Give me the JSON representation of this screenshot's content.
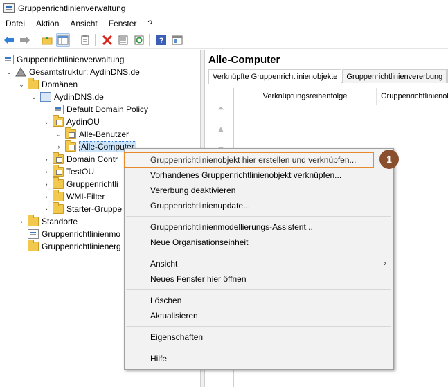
{
  "window": {
    "title": "Gruppenrichtlinienverwaltung"
  },
  "menu": [
    "Datei",
    "Aktion",
    "Ansicht",
    "Fenster",
    "?"
  ],
  "toolbar": {
    "buttons": [
      "back-icon",
      "forward-icon",
      "up-folder-icon",
      "show-hide-tree-icon",
      "clipboard-icon",
      "delete-icon",
      "properties-icon",
      "refresh-icon",
      "help-icon",
      "console-icon"
    ]
  },
  "tree": {
    "root": "Gruppenrichtlinienverwaltung",
    "forest": "Gesamtstruktur: AydinDNS.de",
    "domains": "Domänen",
    "domain": "AydinDNS.de",
    "default_policy": "Default Domain Policy",
    "ou": "AydinOU",
    "ou_users": "Alle-Benutzer",
    "ou_computers": "Alle-Computer",
    "domain_controllers": "Domain Contr",
    "testou": "TestOU",
    "gpos": "Gruppenrichtli",
    "wmi": "WMI-Filter",
    "starter": "Starter-Gruppe",
    "sites": "Standorte",
    "modeling": "Gruppenrichtlinienmo",
    "results": "Gruppenrichtlinienerg"
  },
  "right_pane": {
    "title": "Alle-Computer",
    "tabs": [
      "Verknüpfte Gruppenrichtlinienobjekte",
      "Gruppenrichtlinienvererbung",
      "D"
    ],
    "columns": [
      "Verknüpfungsreihenfolge",
      "Gruppenrichtlinienobj"
    ]
  },
  "context_menu": {
    "items": [
      "Gruppenrichtlinienobjekt hier erstellen und verknüpfen...",
      "Vorhandenes Gruppenrichtlinienobjekt verknüpfen...",
      "Vererbung deaktivieren",
      "Gruppenrichtlinienupdate...",
      "Gruppenrichtlinienmodellierungs-Assistent...",
      "Neue Organisationseinheit",
      "Ansicht",
      "Neues Fenster hier öffnen",
      "Löschen",
      "Aktualisieren",
      "Eigenschaften",
      "Hilfe"
    ]
  },
  "annotation": {
    "badge": "1",
    "highlight_color": "#e8892b",
    "badge_color": "#8a4f2f"
  }
}
